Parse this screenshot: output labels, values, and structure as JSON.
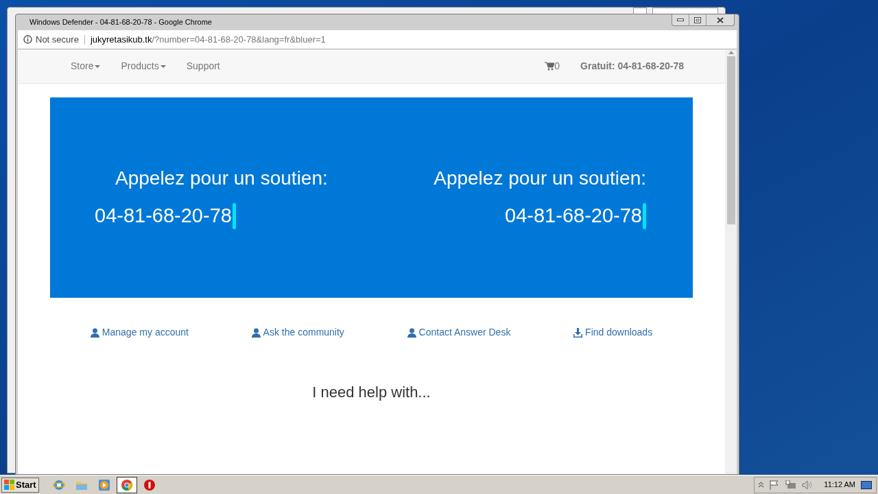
{
  "window": {
    "title": "Windows Defender - 04-81-68-20-78 - Google Chrome"
  },
  "address_bar": {
    "security": "Not secure",
    "host": "jukyretasikub.tk",
    "path": "/?number=04-81-68-20-78&lang=fr&bluer=1"
  },
  "nav": {
    "items": [
      {
        "label": "Store",
        "dropdown": true
      },
      {
        "label": "Products",
        "dropdown": true
      },
      {
        "label": "Support",
        "dropdown": false
      }
    ],
    "cart_count": "0",
    "phone": "Gratuit: 04-81-68-20-78"
  },
  "banner": {
    "panels": [
      {
        "heading": "Appelez pour un soutien:",
        "number": "04-81-68-20-78",
        "kind": "left"
      },
      {
        "heading": "Appelez pour un soutien:",
        "number": "04-81-68-20-78",
        "kind": "right"
      }
    ]
  },
  "links": [
    {
      "label": "Manage my account",
      "kind": "person"
    },
    {
      "label": "Ask the community",
      "kind": "person"
    },
    {
      "label": "Contact Answer Desk",
      "kind": "person"
    },
    {
      "label": "Find downloads",
      "kind": "download"
    }
  ],
  "help_heading": "I need help with...",
  "taskbar": {
    "start": "Start",
    "apps": [
      {
        "kind": "ie",
        "selected": false
      },
      {
        "kind": "folder",
        "selected": false
      },
      {
        "kind": "media",
        "selected": false
      },
      {
        "kind": "chrome",
        "selected": true
      },
      {
        "kind": "stop",
        "selected": false
      }
    ],
    "clock": "11:12 AM"
  }
}
